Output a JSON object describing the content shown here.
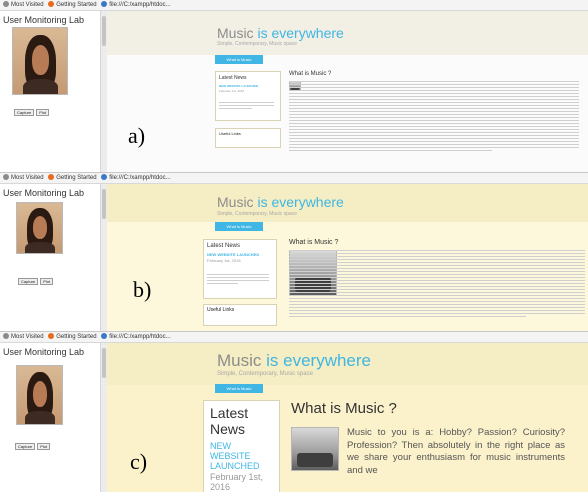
{
  "bookmarks": {
    "most_visited": "Most Visited",
    "getting_started": "Getting Started",
    "address": "file:///C:/xampp/htdoc..."
  },
  "app": {
    "title": "User Monitoring Lab",
    "capture_label": "Capture",
    "plot_label": "Plot"
  },
  "site": {
    "brand_prefix": "Music ",
    "brand_highlight": "is everywhere",
    "tagline": "Simple, Contemporary, Music space",
    "nav_item": "What is Music",
    "news_title_a": "Latest News",
    "news_title_c": "Latest News",
    "news_headline": "NEW WEBSITE LAUNCHED",
    "news_date": "February 1st, 2016",
    "useful_links": "Useful Links",
    "article_title": "What is Music ?",
    "article_text_c": "Music to you is a: Hobby? Passion? Curiosity? Profession? Then absolutely in the right place as we share your enthusiasm for music instruments and we"
  },
  "labels": {
    "a": "a)",
    "b": "b)",
    "c": "c)"
  },
  "colors": {
    "accent": "#3fb6e3",
    "bg_a": "#fbfbfb",
    "bg_b": "#fdf8dc",
    "bg_c": "#fbf2cc"
  }
}
